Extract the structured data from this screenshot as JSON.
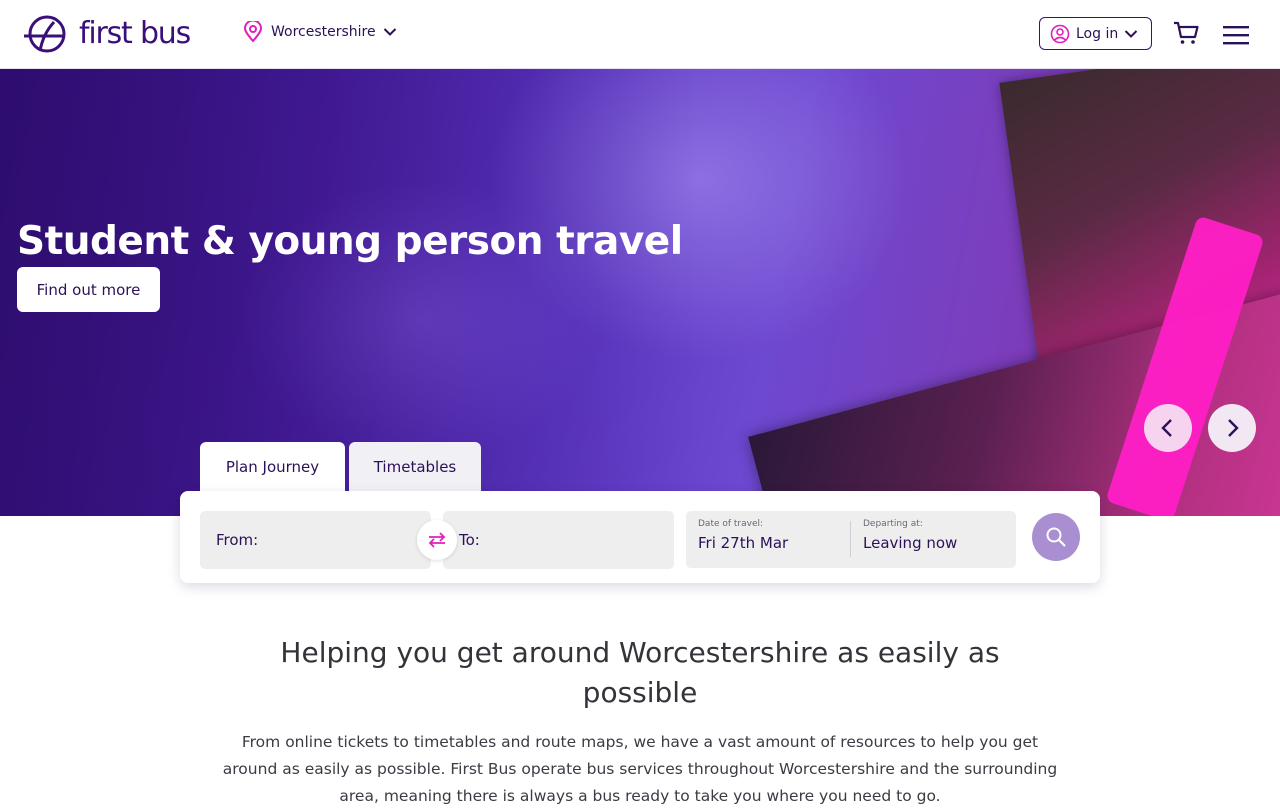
{
  "header": {
    "logo_text": "first bus",
    "region": "Worcestershire",
    "login_label": "Log in"
  },
  "hero": {
    "title": "Student & young person travel",
    "cta": "Find out more"
  },
  "journey": {
    "tabs": [
      "Plan Journey",
      "Timetables"
    ],
    "from_label": "From:",
    "to_label": "To:",
    "date_label": "Date of travel:",
    "date_value": "Fri 27th Mar",
    "depart_label": "Departing at:",
    "depart_value": "Leaving now"
  },
  "content": {
    "heading": "Helping you get around Worcestershire as easily as possible",
    "body": "From online tickets to timetables and route maps, we have a vast amount of resources to help you get around as easily as possible. First Bus operate bus services throughout Worcestershire and the surrounding area, meaning there is always a bus ready to take you where you need to go."
  },
  "colors": {
    "brand": "#3a0f7a",
    "accent_pink": "#e41fb9",
    "search_button": "#a98fd2"
  },
  "icons": [
    "first-bus-logo-icon",
    "location-pin-icon",
    "chevron-down-icon",
    "user-icon",
    "cart-icon",
    "hamburger-menu-icon",
    "chevron-left-icon",
    "chevron-right-icon",
    "swap-icon",
    "search-icon"
  ]
}
